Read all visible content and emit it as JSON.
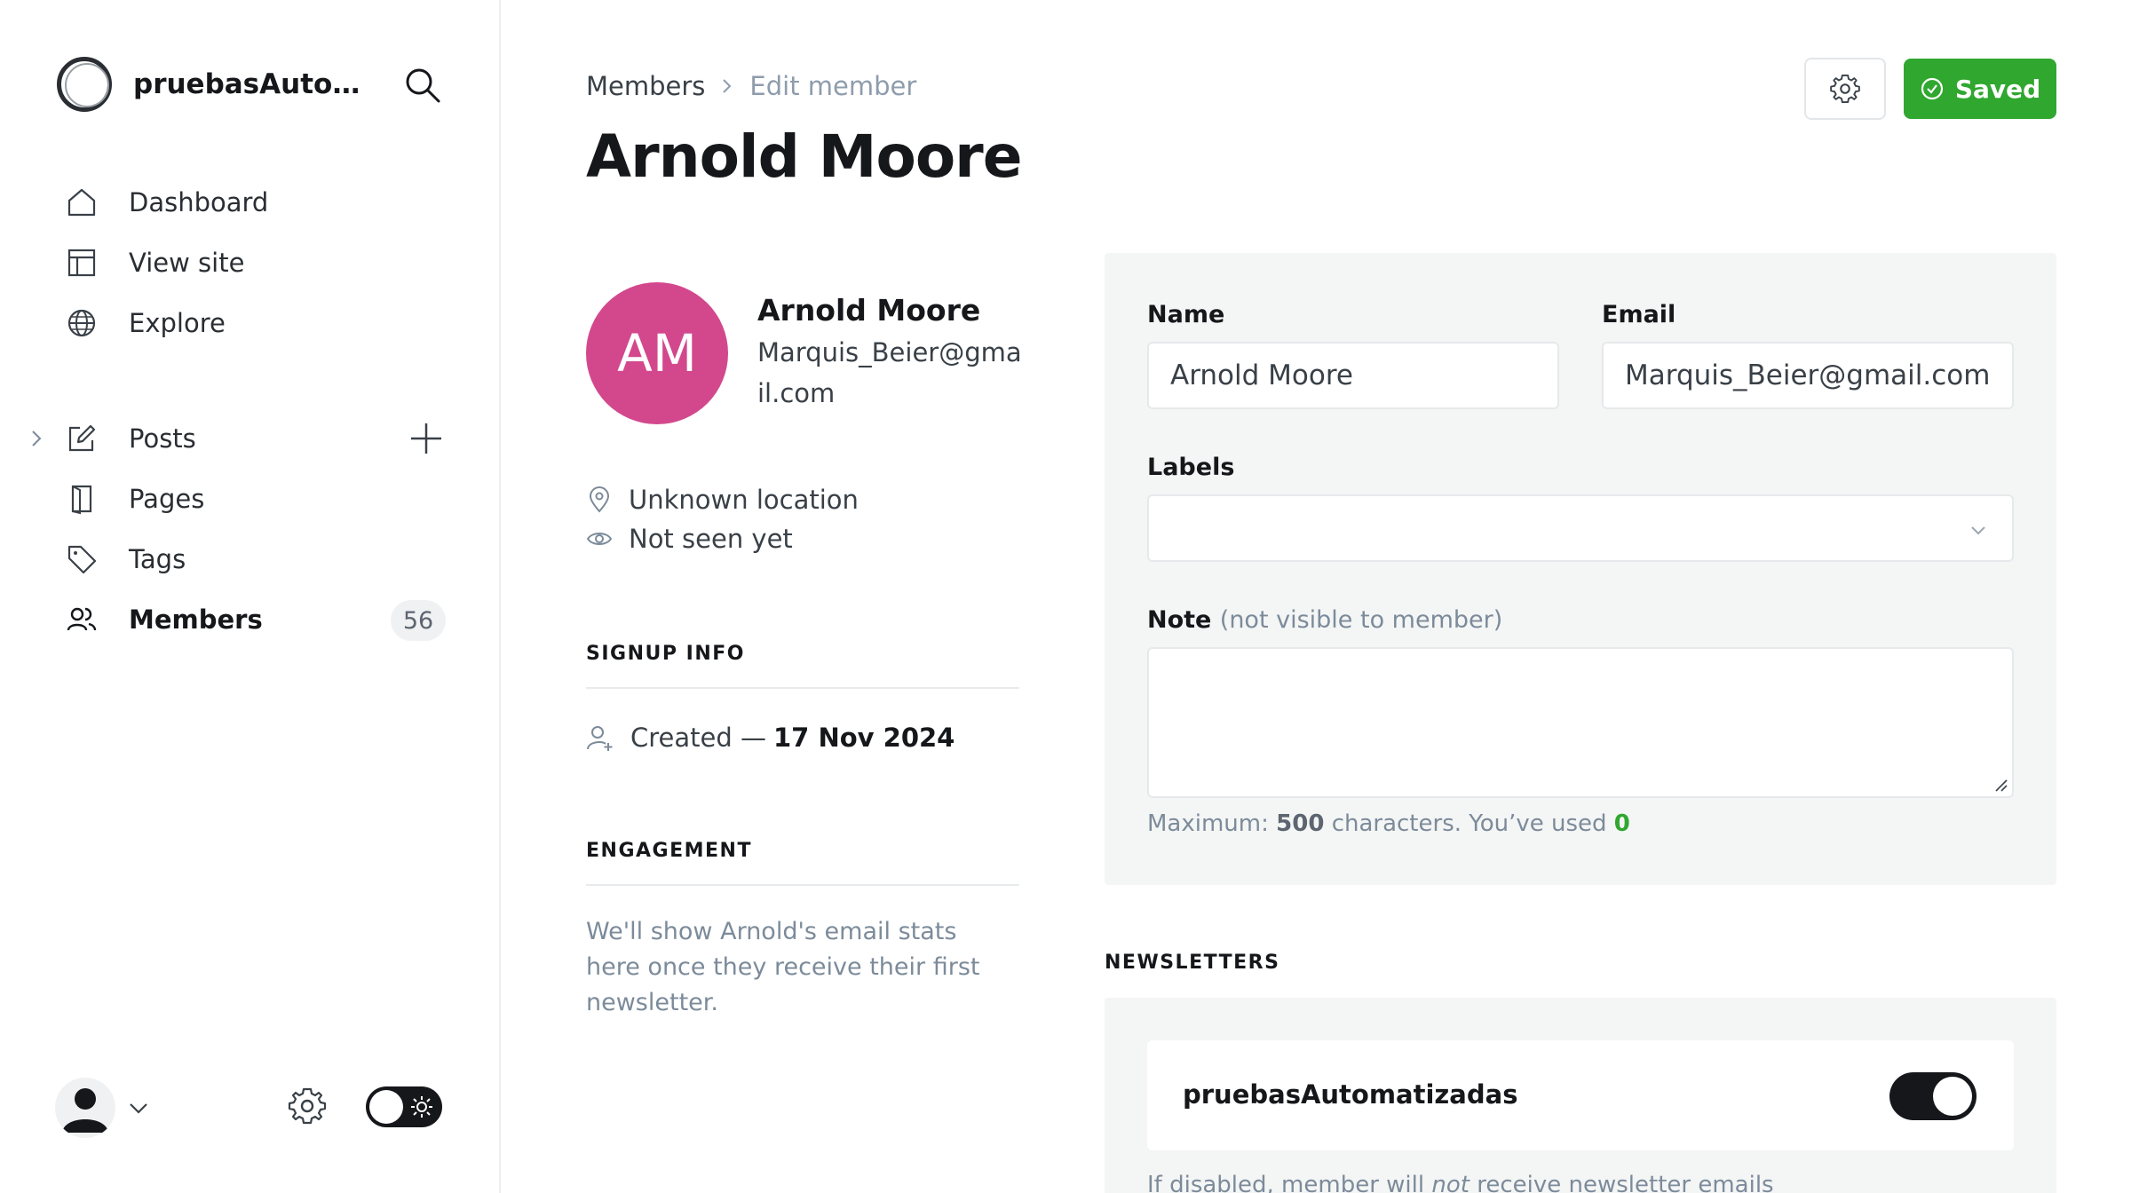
{
  "sidebar": {
    "site_name": "pruebasAutoma...",
    "nav_top": [
      {
        "label": "Dashboard",
        "icon": "home-icon"
      },
      {
        "label": "View site",
        "icon": "layout-icon"
      },
      {
        "label": "Explore",
        "icon": "globe-icon"
      }
    ],
    "nav_content": [
      {
        "label": "Posts",
        "icon": "pencil-square-icon"
      },
      {
        "label": "Pages",
        "icon": "page-icon"
      },
      {
        "label": "Tags",
        "icon": "tag-icon"
      },
      {
        "label": "Members",
        "icon": "users-icon",
        "count": "56",
        "active": true
      }
    ]
  },
  "header": {
    "breadcrumb_parent": "Members",
    "breadcrumb_current": "Edit member",
    "title": "Arnold Moore",
    "save_label": "Saved"
  },
  "member": {
    "initials": "AM",
    "name": "Arnold Moore",
    "email": "Marquis_Beier@gmail.com",
    "location": "Unknown location",
    "last_seen": "Not seen yet",
    "signup_heading": "SIGNUP INFO",
    "created_prefix": "Created —",
    "created_date": "17 Nov 2024",
    "engagement_heading": "ENGAGEMENT",
    "engagement_text": "We'll show Arnold's email stats here once they receive their first newsletter."
  },
  "form": {
    "name_label": "Name",
    "name_value": "Arnold Moore",
    "email_label": "Email",
    "email_value": "Marquis_Beier@gmail.com",
    "labels_label": "Labels",
    "note_label": "Note",
    "note_sub": "(not visible to member)",
    "hint_prefix": "Maximum:",
    "hint_max": "500",
    "hint_middle": "characters. You’ve used",
    "hint_used": "0"
  },
  "newsletters": {
    "heading": "NEWSLETTERS",
    "name": "pruebasAutomatizadas",
    "subscribed": true,
    "hint_prefix": "If disabled, member will",
    "hint_em": "not",
    "hint_suffix": "receive newsletter emails"
  },
  "colors": {
    "accent_green": "#30a72f",
    "avatar_pink": "#d3488d"
  }
}
